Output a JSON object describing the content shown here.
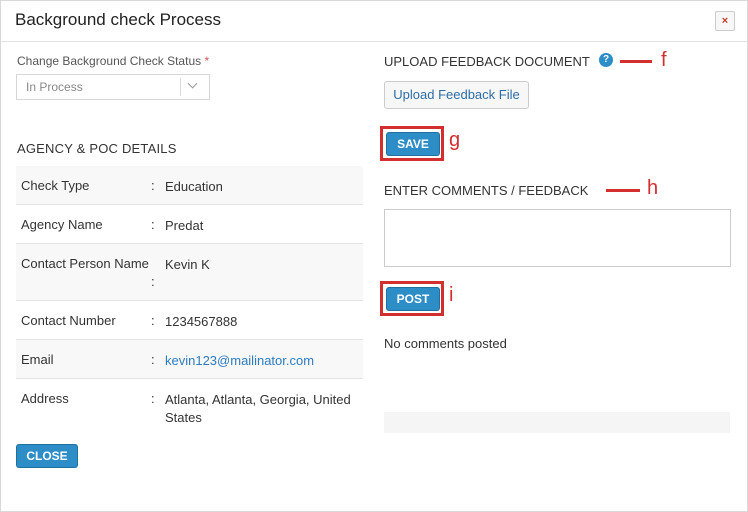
{
  "modal": {
    "title": "Background check Process",
    "close_icon": "×"
  },
  "status": {
    "label": "Change Background Check Status",
    "required_mark": "*",
    "selected": "In Process"
  },
  "agency": {
    "title": "AGENCY & POC DETAILS",
    "rows": [
      {
        "key": "Check Type",
        "value": "Education"
      },
      {
        "key": "Agency Name",
        "value": "Predat"
      },
      {
        "key": "Contact Person Name",
        "value": "Kevin K"
      },
      {
        "key": "Contact Number",
        "value": "1234567888"
      },
      {
        "key": "Email",
        "value": "kevin123@mailinator.com"
      },
      {
        "key": "Address",
        "value": "Atlanta, Atlanta, Georgia, United States"
      }
    ],
    "colon": ":"
  },
  "upload": {
    "title": "UPLOAD FEEDBACK DOCUMENT",
    "help_icon": "?",
    "button_label": "Upload Feedback File"
  },
  "save_label": "SAVE",
  "comments": {
    "title": "ENTER COMMENTS / FEEDBACK",
    "post_label": "POST",
    "empty_text": "No comments posted"
  },
  "close_label": "CLOSE",
  "annotations": {
    "f": "f",
    "g": "g",
    "h": "h",
    "i": "i",
    "color": "#d32f2f"
  }
}
